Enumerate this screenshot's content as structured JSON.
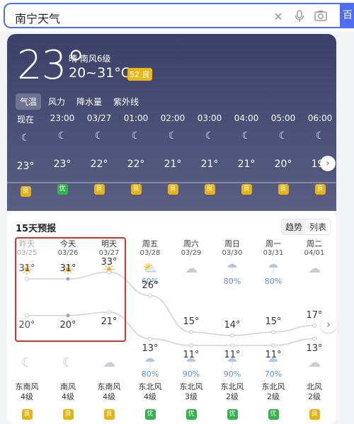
{
  "search": {
    "query": "南宁天气",
    "button": "百"
  },
  "current": {
    "temp": "23°",
    "condition": "晴  南风6级",
    "range": "20~31°C",
    "aqi": "52 良"
  },
  "tabs": [
    "气温",
    "风力",
    "降水量",
    "紫外线"
  ],
  "hourly": [
    {
      "label": "现在",
      "temp": "23°",
      "aqi": "良",
      "aqi_color": "#e8b30c"
    },
    {
      "label": "23:00",
      "temp": "23°",
      "aqi": "优",
      "aqi_color": "#33b34a"
    },
    {
      "label": "03/27",
      "temp": "22°",
      "aqi": "良",
      "aqi_color": "#e8b30c"
    },
    {
      "label": "01:00",
      "temp": "22°",
      "aqi": "良",
      "aqi_color": "#e8b30c"
    },
    {
      "label": "02:00",
      "temp": "21°",
      "aqi": "良",
      "aqi_color": "#e8b30c"
    },
    {
      "label": "03:00",
      "temp": "21°",
      "aqi": "良",
      "aqi_color": "#e8b30c"
    },
    {
      "label": "04:00",
      "temp": "21°",
      "aqi": "良",
      "aqi_color": "#e8b30c"
    },
    {
      "label": "05:00",
      "temp": "20°",
      "aqi": "良",
      "aqi_color": "#e8b30c"
    },
    {
      "label": "06:00",
      "temp": "19°",
      "aqi": "良",
      "aqi_color": "#e8b30c"
    }
  ],
  "forecast": {
    "title": "15天预报",
    "toggle": [
      "趋势",
      "列表"
    ],
    "days": [
      {
        "name": "昨天",
        "date": "03/25",
        "icon": "sun",
        "prob": "",
        "high": "31°",
        "low": "20°",
        "night_icon": "moon",
        "night_prob": "",
        "wind": "东南风",
        "level": "4级",
        "aqi": "良",
        "aqi_color": "#e8b30c",
        "past": true
      },
      {
        "name": "今天",
        "date": "03/26",
        "icon": "sun",
        "prob": "",
        "high": "31°",
        "low": "20°",
        "night_icon": "moon",
        "night_prob": "",
        "wind": "南风",
        "level": "4级",
        "aqi": "良",
        "aqi_color": "#e8b30c",
        "past": false
      },
      {
        "name": "明天",
        "date": "03/27",
        "icon": "sun",
        "prob": "",
        "high": "33°",
        "low": "21°",
        "night_icon": "cloud",
        "night_prob": "",
        "wind": "东南风",
        "level": "4级",
        "aqi": "良",
        "aqi_color": "#e8b30c",
        "past": false
      },
      {
        "name": "周五",
        "date": "03/28",
        "icon": "sun-cloud-rain",
        "prob": "60%",
        "high": "26°",
        "low": "13°",
        "night_icon": "rain",
        "night_prob": "80%",
        "wind": "东北风",
        "level": "4级",
        "aqi": "优",
        "aqi_color": "#33b34a",
        "past": false
      },
      {
        "name": "周六",
        "date": "03/29",
        "icon": "cloud",
        "prob": "",
        "high": "15°",
        "low": "11°",
        "night_icon": "rain",
        "night_prob": "90%",
        "wind": "东北风",
        "level": "3级",
        "aqi": "优",
        "aqi_color": "#33b34a",
        "past": false
      },
      {
        "name": "周日",
        "date": "03/30",
        "icon": "rain",
        "prob": "80%",
        "high": "14°",
        "low": "11°",
        "night_icon": "rain",
        "night_prob": "90%",
        "wind": "东北风",
        "level": "2级",
        "aqi": "优",
        "aqi_color": "#33b34a",
        "past": false
      },
      {
        "name": "周一",
        "date": "03/31",
        "icon": "rain",
        "prob": "80%",
        "high": "15°",
        "low": "11°",
        "night_icon": "rain",
        "night_prob": "70%",
        "wind": "东北风",
        "level": "2级",
        "aqi": "优",
        "aqi_color": "#33b34a",
        "past": false
      },
      {
        "name": "周二",
        "date": "04/01",
        "icon": "cloud",
        "prob": "",
        "high": "17°",
        "low": "13°",
        "night_icon": "cloud",
        "night_prob": "",
        "wind": "北风",
        "level": "2级",
        "aqi": "良",
        "aqi_color": "#e8b30c",
        "past": false
      }
    ]
  }
}
